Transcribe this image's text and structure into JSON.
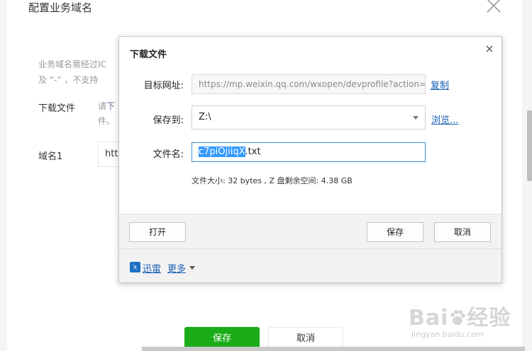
{
  "background_page": {
    "title": "配置业务域名",
    "description_line1": "业务域名需经过IC",
    "description_line2": "及 “-” ，不支持",
    "download_label": "下载文件",
    "download_hint_prefix": "请",
    "download_hint_link": "下",
    "download_hint_line2": "件。",
    "domain_label": "域名1",
    "domain_value": "htt",
    "save_button": "保存",
    "cancel_button": "取消"
  },
  "dialog": {
    "title": "下载文件",
    "url_label": "目标网址:",
    "url_value": "https://mp.weixin.qq.com/wxopen/devprofile?action=",
    "copy_link": "复制",
    "save_to_label": "保存到:",
    "save_to_value": "Z:\\",
    "browse_link": "浏览...",
    "filename_label": "文件名:",
    "filename_selected": "c7piOjiiqX",
    "filename_ext": ".txt",
    "file_info": "文件大小: 32 bytes , Z 盘剩余空间: 4.38 GB",
    "open_button": "打开",
    "save_button": "保存",
    "cancel_button": "取消",
    "xunlei_link": "迅雷",
    "more_link": "更多"
  },
  "watermark": {
    "main": "Bai",
    "logo_text": "经验",
    "sub": "jingyan.baidu.com"
  },
  "colors": {
    "primary_green": "#1aad19",
    "link_blue": "#1a5fb4",
    "selection_blue": "#3399ff",
    "focus_border": "#3d8fd6"
  }
}
